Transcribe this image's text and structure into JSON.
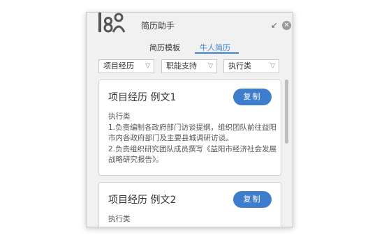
{
  "header": {
    "title": "简历助手",
    "shrink_icon": "shrink-arrow-icon",
    "close_icon": "close-icon"
  },
  "tabs": [
    {
      "label": "简历模板"
    },
    {
      "label": "牛人简历"
    }
  ],
  "filters": [
    {
      "selected": "项目经历"
    },
    {
      "selected": "职能支持"
    },
    {
      "selected": "执行类"
    }
  ],
  "cards": [
    {
      "title": "项目经历 例文1",
      "button": "复制",
      "lines": [
        "执行类",
        "1.负责编制各政府部门访谈提纲，组织团队前往益阳",
        "市内各政府部门及主要县城调研访谈。",
        "2.负责组织研究团队成员撰写《益阳市经济社会发展",
        "战略研究报告》。"
      ]
    },
    {
      "title": "项目经历 例文2",
      "button": "复制",
      "lines": [
        "执行类"
      ]
    }
  ],
  "colors": {
    "accent": "#3d7dcc",
    "tab_active": "#3d86d6"
  }
}
